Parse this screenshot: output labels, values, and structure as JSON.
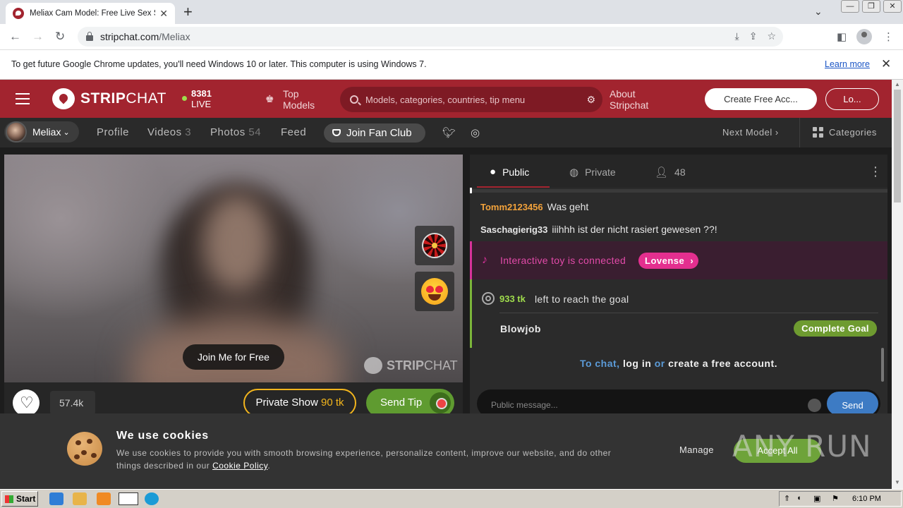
{
  "browser": {
    "tab_title": "Meliax Cam Model: Free Live Sex Sh",
    "url_host": "stripchat.com",
    "url_path": "/Meliax",
    "infobar_message": "To get future Google Chrome updates, you'll need Windows 10 or later. This computer is using Windows 7.",
    "infobar_link": "Learn more"
  },
  "header": {
    "logo_bold": "STRIP",
    "logo_light": "CHAT",
    "live_count": "8381",
    "live_label": "LIVE",
    "top_models_line1": "Top",
    "top_models_line2": "Models",
    "search_placeholder": "Models, categories, countries, tip menu",
    "about_line1": "About",
    "about_line2": "Stripchat",
    "create_account": "Create Free Acc...",
    "login": "Lo..."
  },
  "model_nav": {
    "model_name": "Meliax",
    "profile": "Profile",
    "videos": "Videos",
    "videos_count": "3",
    "photos": "Photos",
    "photos_count": "54",
    "feed": "Feed",
    "join_fan_club": "Join Fan Club",
    "next_model": "Next Model",
    "categories": "Categories"
  },
  "video": {
    "join_free": "Join Me for Free",
    "watermark_bold": "STRIP",
    "watermark_light": "CHAT",
    "likes": "57.4k",
    "private_show": "Private Show",
    "private_price": "90 tk",
    "send_tip": "Send Tip"
  },
  "chat": {
    "tab_public": "Public",
    "tab_private": "Private",
    "viewers": "48",
    "messages": [
      {
        "user": "Tomm2123456",
        "text": "Was geht"
      },
      {
        "user": "Saschagierig33",
        "text": "iiihhh ist der nicht rasiert gewesen ??!"
      }
    ],
    "lovense_text": "Interactive toy is connected",
    "lovense_badge": "Lovense",
    "goal_tokens": "933 tk",
    "goal_text": "left to reach the goal",
    "goal_name": "Blowjob",
    "complete_goal": "Complete Goal",
    "to_chat": "To chat,",
    "log_in": "log in",
    "or": "or",
    "create_free": "create a free account.",
    "input_placeholder": "Public message...",
    "send": "Send"
  },
  "cookies": {
    "title": "We use cookies",
    "text": "We use cookies to provide you with smooth browsing experience, personalize content, improve our website, and do other things described in our",
    "policy_link": "Cookie Policy",
    "manage": "Manage",
    "accept_all": "Accept All"
  },
  "watermark": "ANY RUN",
  "taskbar": {
    "start": "Start",
    "time": "6:10 PM"
  },
  "colors": {
    "brand_red": "#a2242f",
    "tip_green": "#5f9b30",
    "private_gold": "#f2b51d",
    "lovense_pink": "#e42f8f"
  }
}
